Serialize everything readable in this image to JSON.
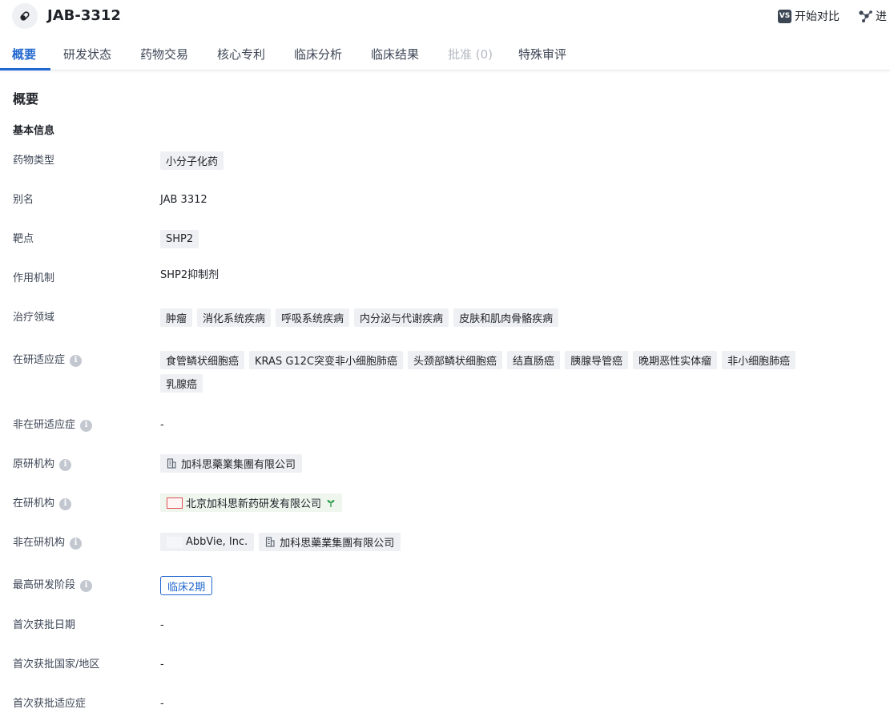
{
  "header": {
    "title": "JAB-3312",
    "compare_label": "开始对比",
    "compare_icon_text": "VS",
    "more_label": "进"
  },
  "tabs": [
    {
      "label": "概要",
      "state": "active"
    },
    {
      "label": "研发状态",
      "state": "normal"
    },
    {
      "label": "药物交易",
      "state": "normal"
    },
    {
      "label": "核心专利",
      "state": "normal"
    },
    {
      "label": "临床分析",
      "state": "normal"
    },
    {
      "label": "临床结果",
      "state": "normal"
    },
    {
      "label": "批准 (0)",
      "state": "disabled"
    },
    {
      "label": "特殊审评",
      "state": "normal"
    }
  ],
  "overview": {
    "section_title": "概要",
    "basic_info_title": "基本信息",
    "drug_type": {
      "label": "药物类型",
      "tags": [
        "小分子化药"
      ]
    },
    "alias": {
      "label": "别名",
      "value": "JAB 3312"
    },
    "target": {
      "label": "靶点",
      "tags": [
        "SHP2"
      ]
    },
    "mechanism": {
      "label": "作用机制",
      "value": "SHP2抑制剂"
    },
    "therapeutic_area": {
      "label": "治疗领域",
      "tags": [
        "肿瘤",
        "消化系统疾病",
        "呼吸系统疾病",
        "内分泌与代谢疾病",
        "皮肤和肌肉骨骼疾病"
      ]
    },
    "active_indications": {
      "label": "在研适应症",
      "tags": [
        "食管鳞状细胞癌",
        "KRAS G12C突变非小细胞肺癌",
        "头颈部鳞状细胞癌",
        "结直肠癌",
        "胰腺导管癌",
        "晚期恶性实体瘤",
        "非小细胞肺癌",
        "乳腺癌"
      ]
    },
    "inactive_indications": {
      "label": "非在研适应症",
      "value": "-"
    },
    "originator": {
      "label": "原研机构",
      "orgs": [
        "加科思藥業集團有限公司"
      ]
    },
    "active_orgs": {
      "label": "在研机构",
      "orgs": [
        "北京加科思新药研发有限公司"
      ]
    },
    "inactive_orgs": {
      "label": "非在研机构",
      "orgs": [
        "AbbVie, Inc.",
        "加科思藥業集團有限公司"
      ]
    },
    "highest_phase": {
      "label": "最高研发阶段",
      "value": "临床2期"
    },
    "first_approval_date": {
      "label": "首次获批日期",
      "value": "-"
    },
    "first_approval_country": {
      "label": "首次获批国家/地区",
      "value": "-"
    },
    "first_approval_indication": {
      "label": "首次获批适应症",
      "value": "-"
    }
  },
  "colors": {
    "accent": "#2368d0",
    "tag_bg": "#eef0f3",
    "disabled": "#b4b9c2"
  }
}
